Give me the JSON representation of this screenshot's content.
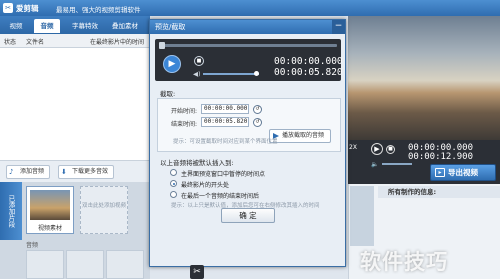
{
  "window": {
    "app_name": "爱剪辑",
    "slogan": "最易用、强大的视频剪辑软件"
  },
  "main_tabs": [
    {
      "label": "视频"
    },
    {
      "label": "音频"
    },
    {
      "label": "字幕特效"
    },
    {
      "label": "叠加素材"
    }
  ],
  "audio_list": {
    "columns": [
      "状态",
      "文件名",
      "在最终影片中的时间"
    ],
    "add_audio": "添加音频",
    "download_more": "下载更多音效"
  },
  "timeline": {
    "added_clips_tab": "已添加片段",
    "clip_label": "视频素材",
    "empty_clip_hint": "双击此处添加视频",
    "audio_label": "音频"
  },
  "right_player": {
    "speed": "2X",
    "time_current": "00:00:00.000",
    "time_total": "00:00:12.900",
    "volume_label": "音量"
  },
  "export_button": "导出视频",
  "info_panel": {
    "title": "所有制作的信息:"
  },
  "dialog": {
    "title": "预览/截取",
    "close": "−",
    "player": {
      "time_current": "00:00:00.000",
      "time_total": "00:00:05.820",
      "volume_level": 0.95
    },
    "trim": {
      "section_label": "截取:",
      "start_label": "开始时间:",
      "start_value": "00:00:00.000",
      "end_label": "结束时间:",
      "end_value": "00:00:05.820",
      "play_button": "播放截取的音频",
      "hint": "提示：可设置截取时间对应到某个界面位置"
    },
    "insert": {
      "section_label": "以上音频将被默认插入到:",
      "options": [
        {
          "label": "主界面预览窗口中暂停的时间点",
          "selected": false
        },
        {
          "label": "最终影片的开头处",
          "selected": true
        },
        {
          "label": "在最后一个音频的结束时间后",
          "selected": false
        }
      ],
      "hint": "提示：以上只是默认值，添加后您可在右侧修改其插入的时间"
    },
    "ok_button": "确 定"
  },
  "watermark": "软件技巧"
}
